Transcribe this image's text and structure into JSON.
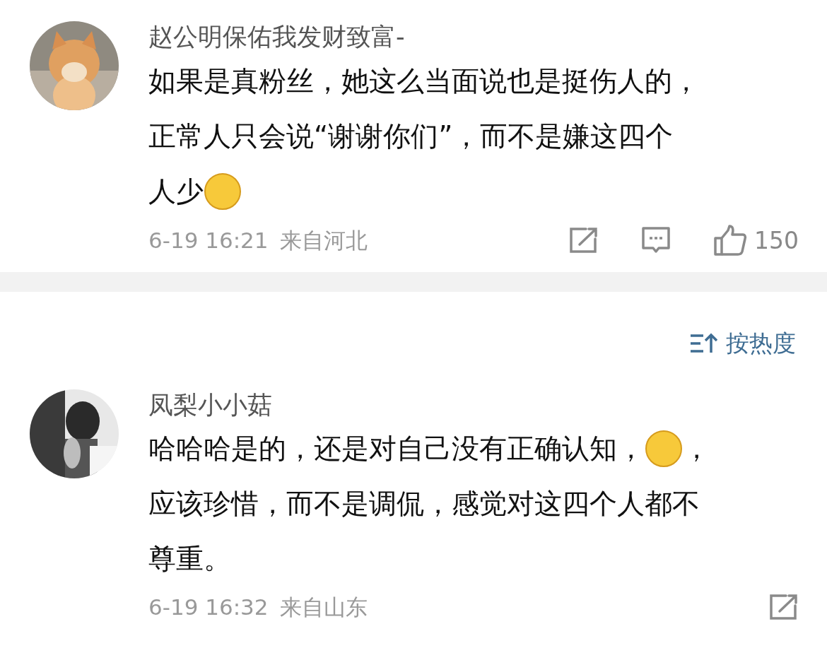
{
  "comments": [
    {
      "username": "赵公明保佑我发财致富-",
      "lines": [
        [
          {
            "kind": "text",
            "text": "如果是真粉丝，她这么当面说也是挺伤人的，"
          }
        ],
        [
          {
            "kind": "text",
            "text": "正常人只会说“谢谢你们”，而不是嫌这四个"
          }
        ],
        [
          {
            "kind": "text",
            "text": "人少"
          },
          {
            "kind": "emoji"
          }
        ]
      ],
      "time": "6-19 16:21",
      "location": "来自河北",
      "actions": [
        {
          "kind": "share"
        },
        {
          "kind": "comment"
        },
        {
          "kind": "like",
          "count": "150"
        }
      ]
    }
  ],
  "sort": {
    "label": "按热度"
  },
  "comments_below": [
    {
      "username": "凤梨小小菇",
      "lines": [
        [
          {
            "kind": "text",
            "text": "哈哈哈是的，还是对自己没有正确认知，"
          },
          {
            "kind": "emoji"
          },
          {
            "kind": "text",
            "text": "，"
          }
        ],
        [
          {
            "kind": "text",
            "text": "应该珍惜，而不是调侃，感觉对这四个人都不"
          }
        ],
        [
          {
            "kind": "text",
            "text": "尊重。"
          }
        ]
      ],
      "time": "6-19 16:32",
      "location": "来自山东",
      "actions": [
        {
          "kind": "share"
        }
      ]
    }
  ]
}
